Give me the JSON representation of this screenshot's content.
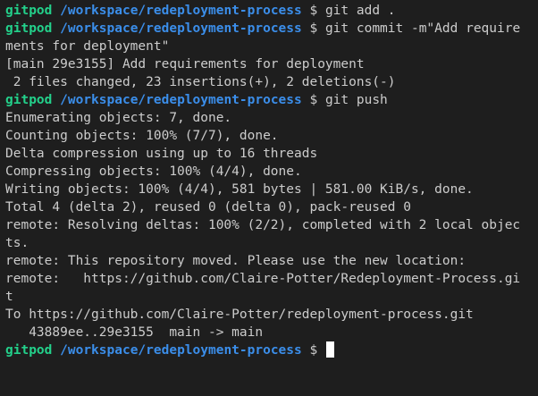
{
  "terminal": {
    "prompt_user": "gitpod",
    "prompt_path": "/workspace/redeployment-process",
    "prompt_symbol": "$",
    "lines": [
      {
        "type": "prompt",
        "cmd": " git add ."
      },
      {
        "type": "prompt",
        "cmd": " git commit -m\"Add require"
      },
      {
        "type": "out",
        "text": "ments for deployment\""
      },
      {
        "type": "out",
        "text": "[main 29e3155] Add requirements for deployment"
      },
      {
        "type": "out",
        "text": " 2 files changed, 23 insertions(+), 2 deletions(-)"
      },
      {
        "type": "prompt",
        "cmd": " git push"
      },
      {
        "type": "out",
        "text": "Enumerating objects: 7, done."
      },
      {
        "type": "out",
        "text": "Counting objects: 100% (7/7), done."
      },
      {
        "type": "out",
        "text": "Delta compression using up to 16 threads"
      },
      {
        "type": "out",
        "text": "Compressing objects: 100% (4/4), done."
      },
      {
        "type": "out",
        "text": "Writing objects: 100% (4/4), 581 bytes | 581.00 KiB/s, done."
      },
      {
        "type": "out",
        "text": "Total 4 (delta 2), reused 0 (delta 0), pack-reused 0"
      },
      {
        "type": "out",
        "text": "remote: Resolving deltas: 100% (2/2), completed with 2 local objec"
      },
      {
        "type": "out",
        "text": "ts."
      },
      {
        "type": "out",
        "text": "remote: This repository moved. Please use the new location:"
      },
      {
        "type": "out",
        "text": "remote:   https://github.com/Claire-Potter/Redeployment-Process.gi"
      },
      {
        "type": "out",
        "text": "t"
      },
      {
        "type": "out",
        "text": "To https://github.com/Claire-Potter/redeployment-process.git"
      },
      {
        "type": "out",
        "text": "   43889ee..29e3155  main -> main"
      },
      {
        "type": "prompt",
        "cmd": " "
      }
    ]
  }
}
